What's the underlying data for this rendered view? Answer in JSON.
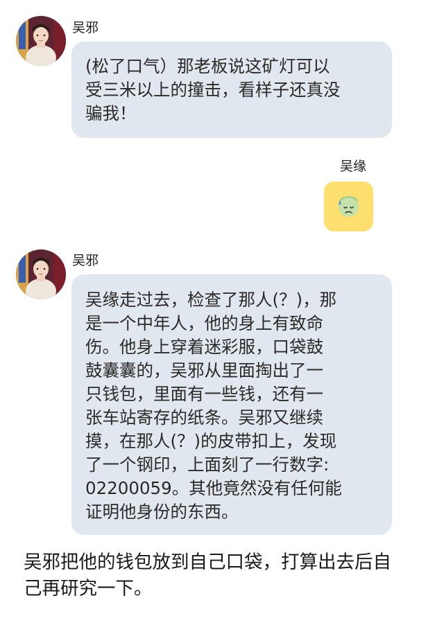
{
  "messages": [
    {
      "sender": "吴邪",
      "side": "left",
      "lines": [
        "(松了口气）那老板说这矿灯可以",
        "受三米以上的撞击，看样子还真没",
        "骗我！"
      ]
    },
    {
      "sender": "吴缘",
      "side": "right",
      "emoji": "sad-sweat-face"
    },
    {
      "sender": "吴邪",
      "side": "left",
      "lines": [
        "吴缘走过去，检查了那人(？)，那",
        "是一个中年人，他的身上有致命",
        "伤。他身上穿着迷彩服，口袋鼓",
        "鼓囊囊的，吴邪从里面掏出了一",
        "只钱包，里面有一些钱，还有一",
        "张车站寄存的纸条。吴邪又继续",
        "摸，在那人(？)的皮带扣上，发现",
        "了一个钢印，上面刻了一行数字:",
        "02200059。其他竟然没有任何能",
        "证明他身份的东西。"
      ]
    }
  ],
  "narration": {
    "lines": [
      "吴邪把他的钱包放到自己口袋，打算出去后自",
      "己再研究一下。"
    ]
  },
  "colors": {
    "bubble": "#e1e7ef",
    "emoji_bubble": "#fde06f",
    "emoji_face": "#c5e3a8",
    "emoji_sweat": "#5b8fd9"
  }
}
